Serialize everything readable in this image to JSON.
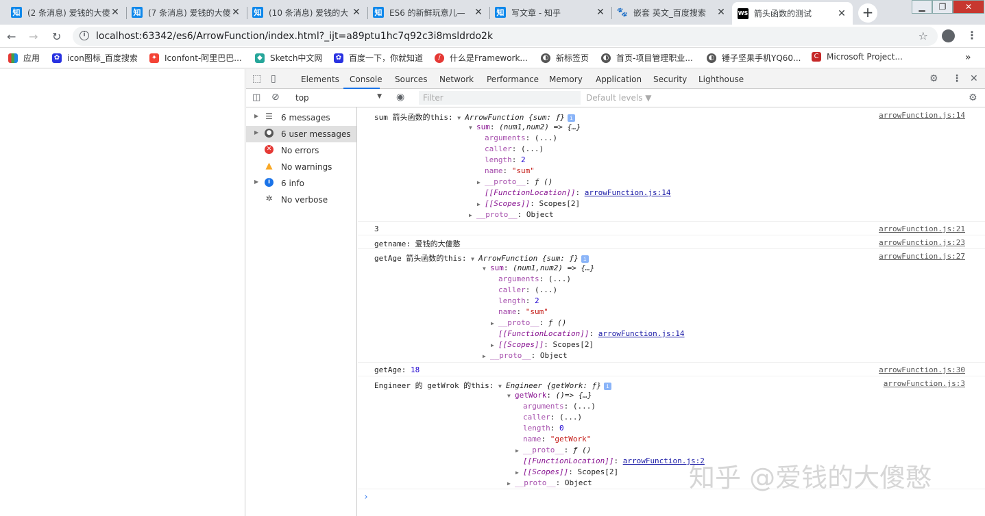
{
  "tabs": [
    {
      "title": "(2 条消息) 爱钱的大傻",
      "fav": "知"
    },
    {
      "title": "(7 条消息) 爱钱的大傻",
      "fav": "知"
    },
    {
      "title": "(10 条消息) 爱钱的大",
      "fav": "知"
    },
    {
      "title": "ES6 的新鲜玩意儿—",
      "fav": "知"
    },
    {
      "title": "写文章 - 知乎",
      "fav": "知"
    },
    {
      "title": "嵌套 英文_百度搜索",
      "fav": "🐾"
    },
    {
      "title": "箭头函数的测试",
      "fav": "WS"
    }
  ],
  "address": {
    "url": "localhost:63342/es6/ArrowFunction/index.html?_ijt=a89ptu1hc7q92c3i8msldrdo2k"
  },
  "bookmarks": [
    {
      "label": "应用",
      "color": "#e53935"
    },
    {
      "label": "icon图标_百度搜索",
      "color": "#2932e1"
    },
    {
      "label": "Iconfont-阿里巴巴...",
      "color": "#f44336"
    },
    {
      "label": "Sketch中文网",
      "color": "#26a69a"
    },
    {
      "label": "百度一下，你就知道",
      "color": "#2932e1"
    },
    {
      "label": "什么是Framework...",
      "color": "#e53935"
    },
    {
      "label": "新标签页",
      "color": "#555555"
    },
    {
      "label": "首页-项目管理职业...",
      "color": "#555555"
    },
    {
      "label": "锤子坚果手机YQ60...",
      "color": "#555555"
    },
    {
      "label": "Microsoft Project...",
      "color": "#c62828"
    }
  ],
  "devtools": {
    "tabs": [
      "Elements",
      "Console",
      "Sources",
      "Network",
      "Performance",
      "Memory",
      "Application",
      "Security",
      "Lighthouse"
    ],
    "context": "top",
    "filter_placeholder": "Filter",
    "levels": "Default levels ▼",
    "sidebar": [
      {
        "label": "6 messages",
        "icon": "list"
      },
      {
        "label": "6 user messages",
        "icon": "user"
      },
      {
        "label": "No errors",
        "icon": "error"
      },
      {
        "label": "No warnings",
        "icon": "warning"
      },
      {
        "label": "6 info",
        "icon": "info"
      },
      {
        "label": "No verbose",
        "icon": "verbose"
      }
    ]
  },
  "console": {
    "sources": [
      "arrowFunction.js:14",
      "arrowFunction.js:21",
      "arrowFunction.js:23",
      "arrowFunction.js:27",
      "arrowFunction.js:30",
      "arrowFunction.js:3"
    ],
    "m1": {
      "prefix": "sum 箭头函数的this: ",
      "cls": "ArrowFunction",
      "sum_preview": "{sum: ƒ}",
      "fn": "(num1,num2) => {…}",
      "args": "arguments",
      "caller": "caller",
      "length": "length",
      "name": "name",
      "len_val": "2",
      "name_val": "\"sum\"",
      "proto_fn": "__proto__",
      "proto_fn_val": "ƒ ()",
      "fl": "[[FunctionLocation]]",
      "fl_val": "arrowFunction.js:14",
      "scopes": "[[Scopes]]",
      "scopes_val": "Scopes[2]",
      "proto_obj": "__proto__",
      "proto_obj_val": "Object",
      "dots": "(...)"
    },
    "m2": {
      "value": "3"
    },
    "m3": {
      "text": "getname: 爱钱的大傻憨"
    },
    "m4": {
      "prefix": "getAge 箭头函数的this: "
    },
    "m5": {
      "text": "getAge: ",
      "val": "18"
    },
    "m6": {
      "prefix": "Engineer 的 getWrok 的this: ",
      "cls": "Engineer",
      "preview": "{getWork: ƒ}",
      "key": "getWork",
      "fn": "()=> {…}",
      "len_val": "0",
      "name_val": "\"getWork\"",
      "fl_val": "arrowFunction.js:2"
    }
  },
  "watermark": "知乎 @爱钱的大傻憨"
}
